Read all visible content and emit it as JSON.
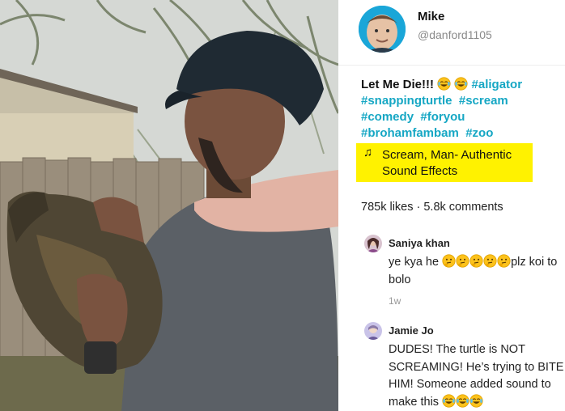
{
  "profile": {
    "username": "Mike",
    "handle": "@danford1105"
  },
  "caption": {
    "text": "Let Me Die!!!",
    "emojis": [
      "face-with-tears-of-joy",
      "face-with-tears-of-joy"
    ],
    "hashtags": [
      "#aligator",
      "#snappingturtle",
      "#scream",
      "#comedy",
      "#foryou",
      "#brohamfambam",
      "#zoo"
    ]
  },
  "sound": {
    "icon": "music-note-icon",
    "title": "Scream, Man- Authentic Sound Effects",
    "highlight_color": "#fff200"
  },
  "stats": {
    "summary": "785k likes · 5.8k comments"
  },
  "comments": [
    {
      "author": "Saniya khan",
      "text_before": "ye kya he",
      "emojis": [
        "thinking-face",
        "thinking-face",
        "thinking-face",
        "thinking-face",
        "thinking-face"
      ],
      "text_after": "plz koi to bolo",
      "time": "1w"
    },
    {
      "author": "Jamie Jo",
      "text_before": "DUDES! The turtle is NOT SCREAMING! He’s trying to BITE HIM! Someone added sound to make this",
      "emojis": [
        "face-with-tears-of-joy",
        "face-with-tears-of-joy",
        "face-with-tears-of-joy"
      ]
    }
  ],
  "colors": {
    "hashtag": "#16a7c4",
    "muted": "#8a8a8a"
  }
}
